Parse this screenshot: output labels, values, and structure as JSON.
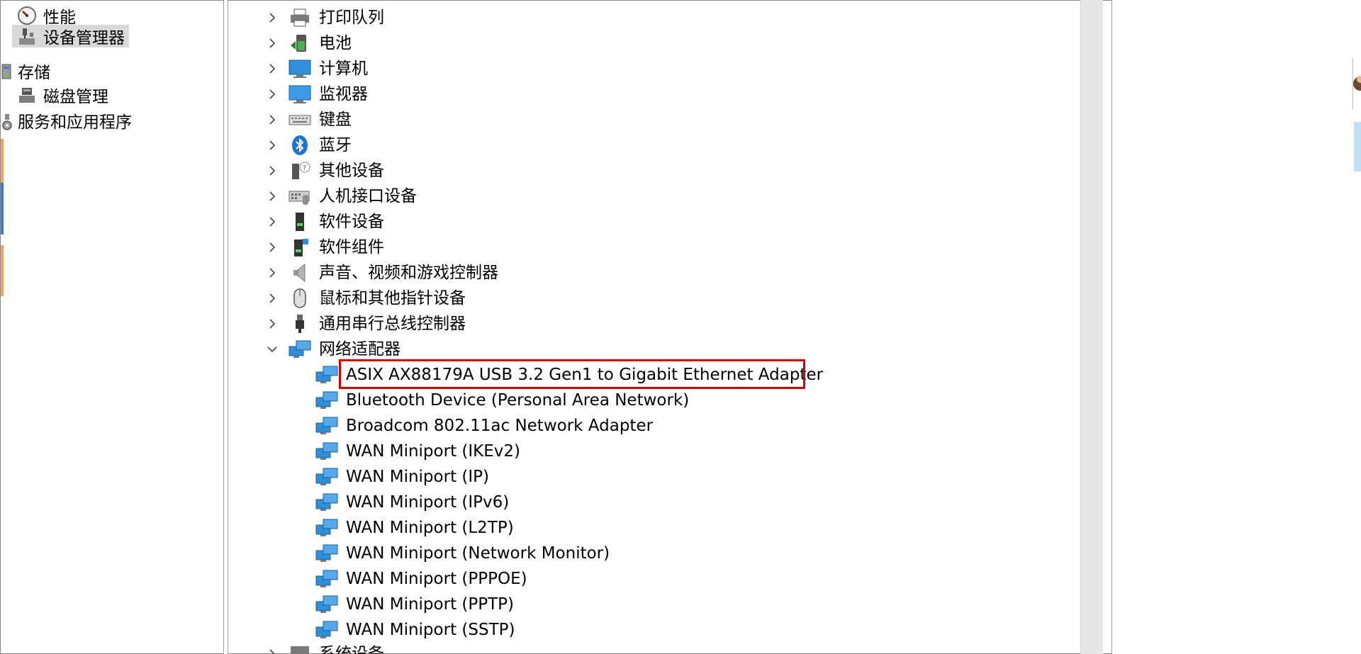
{
  "left_nav": {
    "items": [
      {
        "label": "性能",
        "icon": "performance-gauge-icon"
      },
      {
        "label": "设备管理器",
        "icon": "device-manager-icon",
        "selected": true
      },
      {
        "label": "存储",
        "icon": "storage-icon"
      },
      {
        "label": "磁盘管理",
        "icon": "disk-management-icon"
      },
      {
        "label": "服务和应用程序",
        "icon": "services-icon"
      }
    ]
  },
  "device_tree": {
    "categories": [
      {
        "label": "打印队列",
        "icon": "printer-icon",
        "expanded": false
      },
      {
        "label": "电池",
        "icon": "battery-icon",
        "expanded": false
      },
      {
        "label": "计算机",
        "icon": "computer-icon",
        "expanded": false
      },
      {
        "label": "监视器",
        "icon": "monitor-icon",
        "expanded": false
      },
      {
        "label": "键盘",
        "icon": "keyboard-icon",
        "expanded": false
      },
      {
        "label": "蓝牙",
        "icon": "bluetooth-icon",
        "expanded": false
      },
      {
        "label": "其他设备",
        "icon": "unknown-device-icon",
        "expanded": false
      },
      {
        "label": "人机接口设备",
        "icon": "hid-icon",
        "expanded": false
      },
      {
        "label": "软件设备",
        "icon": "software-device-icon",
        "expanded": false
      },
      {
        "label": "软件组件",
        "icon": "software-component-icon",
        "expanded": false
      },
      {
        "label": "声音、视频和游戏控制器",
        "icon": "speaker-icon",
        "expanded": false
      },
      {
        "label": "鼠标和其他指针设备",
        "icon": "mouse-icon",
        "expanded": false
      },
      {
        "label": "通用串行总线控制器",
        "icon": "usb-icon",
        "expanded": false
      },
      {
        "label": "网络适配器",
        "icon": "network-adapter-icon",
        "expanded": true
      }
    ],
    "network_adapters": [
      {
        "label": "ASIX AX88179A USB 3.2 Gen1 to Gigabit Ethernet Adapter",
        "highlighted": true
      },
      {
        "label": "Bluetooth Device (Personal Area Network)"
      },
      {
        "label": "Broadcom 802.11ac Network Adapter"
      },
      {
        "label": "WAN Miniport (IKEv2)"
      },
      {
        "label": "WAN Miniport (IP)"
      },
      {
        "label": "WAN Miniport (IPv6)"
      },
      {
        "label": "WAN Miniport (L2TP)"
      },
      {
        "label": "WAN Miniport (Network Monitor)"
      },
      {
        "label": "WAN Miniport (PPPOE)"
      },
      {
        "label": "WAN Miniport (PPTP)"
      },
      {
        "label": "WAN Miniport (SSTP)"
      }
    ],
    "partial_next": {
      "label": "系统设备",
      "icon": "system-device-icon"
    }
  },
  "colors": {
    "highlight_border": "#d40000",
    "selected_bg": "#d9d9d9",
    "scrollbar_track": "#e6e6e6",
    "network_icon_blue": "#2f8fd8"
  }
}
